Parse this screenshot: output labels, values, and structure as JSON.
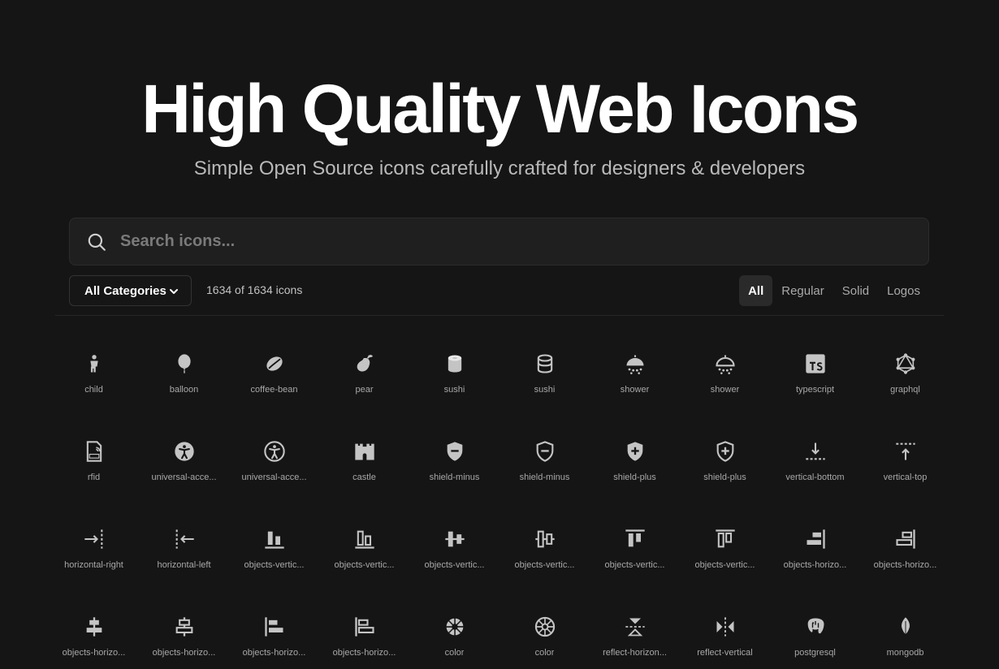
{
  "hero": {
    "title": "High Quality Web Icons",
    "subtitle": "Simple Open Source icons carefully crafted for designers & developers"
  },
  "search": {
    "placeholder": "Search icons..."
  },
  "filters": {
    "category": "All Categories",
    "count": "1634 of 1634 icons",
    "tabs": [
      "All",
      "Regular",
      "Solid",
      "Logos"
    ],
    "active_tab": "All"
  },
  "colors": {
    "background": "#151515",
    "icon": "#c4c4c4"
  },
  "icons": [
    {
      "name": "child",
      "label": "child",
      "style": "solid"
    },
    {
      "name": "balloon",
      "label": "balloon",
      "style": "solid"
    },
    {
      "name": "coffee-bean",
      "label": "coffee-bean",
      "style": "solid"
    },
    {
      "name": "pear",
      "label": "pear",
      "style": "solid"
    },
    {
      "name": "sushi",
      "label": "sushi",
      "style": "solid"
    },
    {
      "name": "sushi",
      "label": "sushi",
      "style": "regular"
    },
    {
      "name": "shower",
      "label": "shower",
      "style": "solid"
    },
    {
      "name": "shower",
      "label": "shower",
      "style": "regular"
    },
    {
      "name": "typescript",
      "label": "typescript",
      "style": "logo"
    },
    {
      "name": "graphql",
      "label": "graphql",
      "style": "logo"
    },
    {
      "name": "rfid",
      "label": "rfid",
      "style": "regular"
    },
    {
      "name": "universal-access",
      "label": "universal-acce...",
      "style": "solid"
    },
    {
      "name": "universal-access",
      "label": "universal-acce...",
      "style": "regular"
    },
    {
      "name": "castle",
      "label": "castle",
      "style": "solid"
    },
    {
      "name": "shield-minus",
      "label": "shield-minus",
      "style": "solid"
    },
    {
      "name": "shield-minus",
      "label": "shield-minus",
      "style": "regular"
    },
    {
      "name": "shield-plus",
      "label": "shield-plus",
      "style": "solid"
    },
    {
      "name": "shield-plus",
      "label": "shield-plus",
      "style": "regular"
    },
    {
      "name": "vertical-bottom",
      "label": "vertical-bottom",
      "style": "regular"
    },
    {
      "name": "vertical-top",
      "label": "vertical-top",
      "style": "regular"
    },
    {
      "name": "horizontal-right",
      "label": "horizontal-right",
      "style": "regular"
    },
    {
      "name": "horizontal-left",
      "label": "horizontal-left",
      "style": "regular"
    },
    {
      "name": "objects-vertical-bottom",
      "label": "objects-vertic...",
      "style": "solid"
    },
    {
      "name": "objects-vertical-bottom",
      "label": "objects-vertic...",
      "style": "regular"
    },
    {
      "name": "objects-vertical-center",
      "label": "objects-vertic...",
      "style": "solid"
    },
    {
      "name": "objects-vertical-center",
      "label": "objects-vertic...",
      "style": "regular"
    },
    {
      "name": "objects-vertical-top",
      "label": "objects-vertic...",
      "style": "solid"
    },
    {
      "name": "objects-vertical-top",
      "label": "objects-vertic...",
      "style": "regular"
    },
    {
      "name": "objects-horizontal-right",
      "label": "objects-horizo...",
      "style": "solid"
    },
    {
      "name": "objects-horizontal-right",
      "label": "objects-horizo...",
      "style": "regular"
    },
    {
      "name": "objects-horizontal-center",
      "label": "objects-horizo...",
      "style": "solid"
    },
    {
      "name": "objects-horizontal-center",
      "label": "objects-horizo...",
      "style": "regular"
    },
    {
      "name": "objects-horizontal-left",
      "label": "objects-horizo...",
      "style": "solid"
    },
    {
      "name": "objects-horizontal-left",
      "label": "objects-horizo...",
      "style": "regular"
    },
    {
      "name": "color",
      "label": "color",
      "style": "solid"
    },
    {
      "name": "color",
      "label": "color",
      "style": "regular"
    },
    {
      "name": "reflect-horizontal",
      "label": "reflect-horizon...",
      "style": "solid"
    },
    {
      "name": "reflect-vertical",
      "label": "reflect-vertical",
      "style": "solid"
    },
    {
      "name": "postgresql",
      "label": "postgresql",
      "style": "logo"
    },
    {
      "name": "mongodb",
      "label": "mongodb",
      "style": "logo"
    }
  ]
}
